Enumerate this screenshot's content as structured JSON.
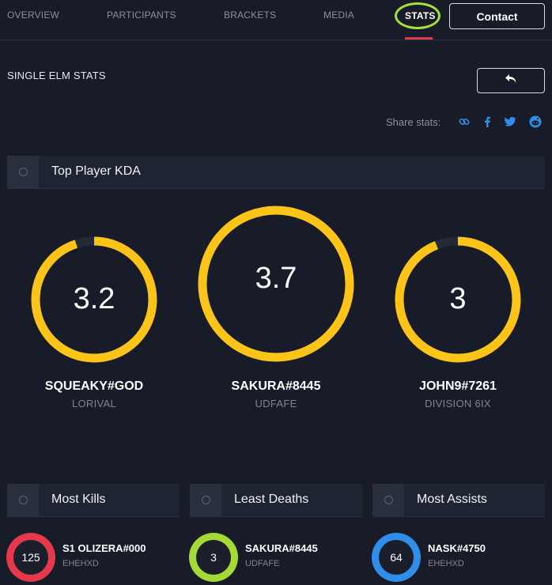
{
  "nav": {
    "items": [
      "OVERVIEW",
      "PARTICIPANTS",
      "BRACKETS",
      "MEDIA",
      "STATS"
    ],
    "contact_label": "Contact"
  },
  "page": {
    "title": "SINGLE ELM STATS",
    "back_icon": "undo-arrow-icon"
  },
  "share": {
    "label": "Share stats:",
    "icons": [
      "link-icon",
      "facebook-icon",
      "twitter-icon",
      "reddit-icon"
    ],
    "icon_color": "#2f8fe8"
  },
  "kda": {
    "section_label": "Top Player KDA",
    "ring_color": "#fcc419",
    "players": [
      {
        "value": "3.2",
        "name": "SQUEAKY#GOD",
        "team": "LORIVAL",
        "fill": 0.95
      },
      {
        "value": "3.7",
        "name": "SAKURA#8445",
        "team": "UDFAFE",
        "fill": 1.0
      },
      {
        "value": "3",
        "name": "JOHN9#7261",
        "team": "DIVISION 6IX",
        "fill": 0.94
      }
    ]
  },
  "leaders": [
    {
      "section_label": "Most Kills",
      "value": "125",
      "name": "S1 OLIZERA#000",
      "team": "EHEHXD",
      "color": "#e6384b"
    },
    {
      "section_label": "Least Deaths",
      "value": "3",
      "name": "SAKURA#8445",
      "team": "UDFAFE",
      "color": "#a4d936"
    },
    {
      "section_label": "Most Assists",
      "value": "64",
      "name": "NASK#4750",
      "team": "EHEHXD",
      "color": "#2f8fe8"
    }
  ]
}
